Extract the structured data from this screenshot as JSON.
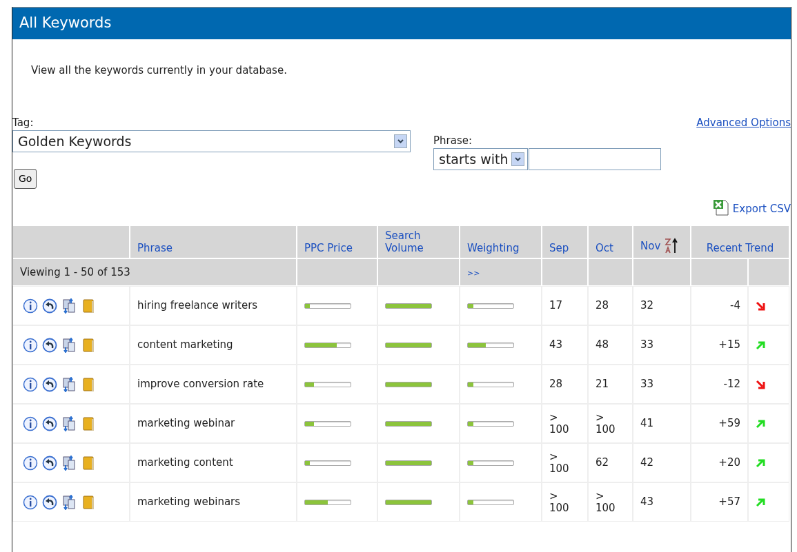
{
  "title": "All Keywords",
  "description": "View all the keywords currently in your database.",
  "filters": {
    "tag_label": "Tag:",
    "tag_value": "Golden Keywords",
    "phrase_label": "Phrase:",
    "phrase_mode": "starts with",
    "advanced_link": "Advanced Options",
    "go_button": "Go"
  },
  "export_link": "Export CSV",
  "table": {
    "columns": [
      {
        "label": "Phrase",
        "sorted": false
      },
      {
        "label": "PPC Price",
        "sorted": false
      },
      {
        "label": "Search Volume",
        "sorted": false
      },
      {
        "label": "Weighting",
        "sorted": false
      },
      {
        "label": "Sep",
        "sorted": false
      },
      {
        "label": "Oct",
        "sorted": false
      },
      {
        "label": "Nov",
        "sorted": true
      },
      {
        "label": "Recent Trend",
        "sorted": false
      }
    ],
    "viewing": "Viewing 1 - 50 of 153",
    "next_link": ">>",
    "rows": [
      {
        "phrase": "hiring freelance writers",
        "ppc": {
          "level": 0.1
        },
        "volume": {
          "level": 1
        },
        "weighting": {
          "level": 0.12
        },
        "sep": "17",
        "oct": "28",
        "nov": "32",
        "trend": "-4",
        "kind": "down"
      },
      {
        "phrase": "content marketing",
        "ppc": {
          "level": 0.7
        },
        "volume": {
          "level": 1
        },
        "weighting": {
          "level": 0.4
        },
        "sep": "43",
        "oct": "48",
        "nov": "33",
        "trend": "+15",
        "kind": "up"
      },
      {
        "phrase": "improve conversion rate",
        "ppc": {
          "level": 0.2
        },
        "volume": {
          "level": 1
        },
        "weighting": {
          "level": 0.12
        },
        "sep": "28",
        "oct": "21",
        "nov": "33",
        "trend": "-12",
        "kind": "down"
      },
      {
        "phrase": "marketing webinar",
        "ppc": {
          "level": 0.2
        },
        "volume": {
          "level": 1
        },
        "weighting": {
          "level": 0.12
        },
        "sep": "> 100",
        "oct": "> 100",
        "nov": "41",
        "trend": "+59",
        "kind": "up"
      },
      {
        "phrase": "marketing content",
        "ppc": {
          "level": 0.1
        },
        "volume": {
          "level": 1
        },
        "weighting": {
          "level": 0.12
        },
        "sep": "> 100",
        "oct": "62",
        "nov": "42",
        "trend": "+20",
        "kind": "up"
      },
      {
        "phrase": "marketing webinars",
        "ppc": {
          "level": 0.5
        },
        "volume": {
          "level": 1
        },
        "weighting": {
          "level": 0.12
        },
        "sep": "> 100",
        "oct": "> 100",
        "nov": "43",
        "trend": "+57",
        "kind": "up"
      }
    ]
  }
}
